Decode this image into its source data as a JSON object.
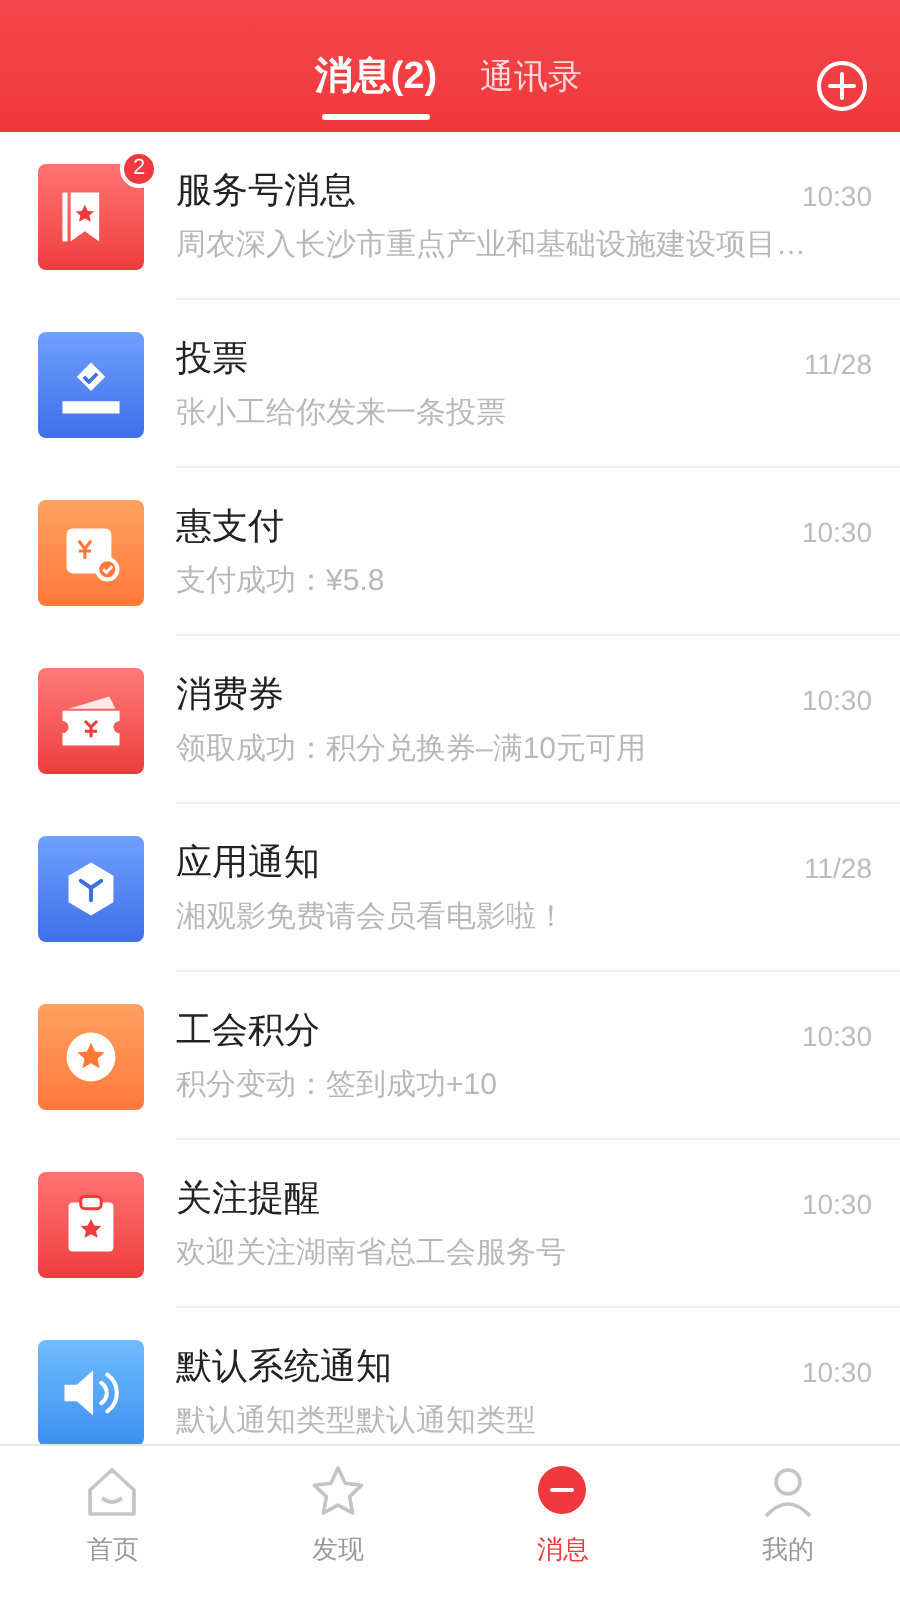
{
  "header": {
    "tabs": [
      {
        "label": "消息(2)",
        "selected": true
      },
      {
        "label": "通讯录",
        "selected": false
      }
    ]
  },
  "messages": [
    {
      "kind": "service",
      "title": "服务号消息",
      "badge": "2",
      "preview": "周农深入长沙市重点产业和基础设施建设项目…",
      "time": "10:30"
    },
    {
      "kind": "vote",
      "title": "投票",
      "preview": "张小工给你发来一条投票",
      "time": "11/28"
    },
    {
      "kind": "pay",
      "title": "惠支付",
      "preview": "支付成功：¥5.8",
      "time": "10:30"
    },
    {
      "kind": "coupon",
      "title": "消费券",
      "preview": "领取成功：积分兑换券–满10元可用",
      "time": "10:30"
    },
    {
      "kind": "app",
      "title": "应用通知",
      "preview": "湘观影免费请会员看电影啦！",
      "time": "11/28"
    },
    {
      "kind": "points",
      "title": "工会积分",
      "preview": "积分变动：签到成功+10",
      "time": "10:30"
    },
    {
      "kind": "follow",
      "title": "关注提醒",
      "preview": "欢迎关注湖南省总工会服务号",
      "time": "10:30"
    },
    {
      "kind": "system",
      "title": "默认系统通知",
      "preview": "默认通知类型默认通知类型",
      "time": "10:30"
    }
  ],
  "tab_bar": [
    {
      "kind": "home",
      "label": "首页",
      "selected": false
    },
    {
      "kind": "discover",
      "label": "发现",
      "selected": false
    },
    {
      "kind": "messages",
      "label": "消息",
      "selected": true
    },
    {
      "kind": "me",
      "label": "我的",
      "selected": false
    }
  ]
}
